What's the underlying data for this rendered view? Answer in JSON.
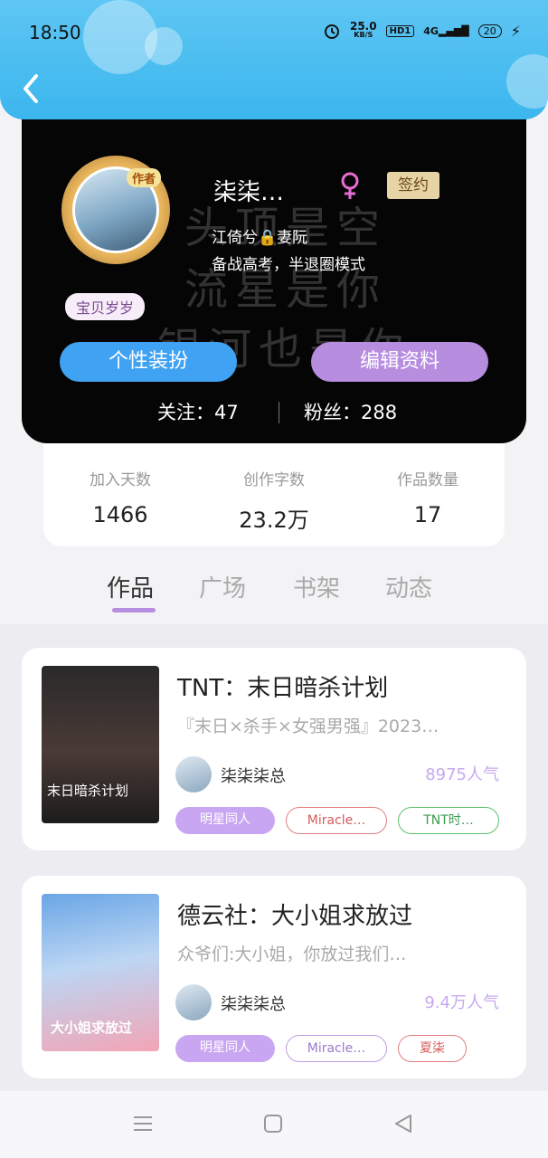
{
  "status": {
    "time": "18:50",
    "speed": "25.0",
    "speed_unit": "KB/S",
    "hd": "HD1",
    "network": "4G",
    "battery": "20"
  },
  "profile": {
    "author_tag": "作者",
    "username": "柒柒…",
    "line1": "江倚兮🔒妻阮",
    "line2": "备战高考，半退圈模式",
    "sign_tag": "签约",
    "gender_icon": "female-icon",
    "baby_tag": "宝贝岁岁",
    "btn_dress": "个性装扮",
    "btn_edit": "编辑资料",
    "follow_label": "关注：47",
    "fans_label": "粉丝：288",
    "bg_lines": [
      "头顶是空",
      "流星是你",
      "银河也是你"
    ]
  },
  "stats": [
    {
      "label": "加入天数",
      "value": "1466"
    },
    {
      "label": "创作字数",
      "value": "23.2万"
    },
    {
      "label": "作品数量",
      "value": "17"
    }
  ],
  "tabs": [
    "作品",
    "广场",
    "书架",
    "动态"
  ],
  "works": [
    {
      "title": "TNT：末日暗杀计划",
      "desc": "『末日×杀手×女强男强』2023…",
      "author": "柒柒柒总",
      "popularity": "8975人气",
      "tags": [
        "明星同人",
        "Miracle…",
        "TNT时…"
      ],
      "cover_text": "末日暗杀计划"
    },
    {
      "title": "德云社：大小姐求放过",
      "desc": "众爷们:大小姐，你放过我们…",
      "author": "柒柒柒总",
      "popularity": "9.4万人气",
      "tags": [
        "明星同人",
        "Miracle…",
        "夏柒"
      ],
      "cover_text": "大小姐求放过"
    }
  ],
  "colors": {
    "accent": "#b78de0",
    "blue": "#3fa2f2",
    "header": "#3bb6ee"
  }
}
